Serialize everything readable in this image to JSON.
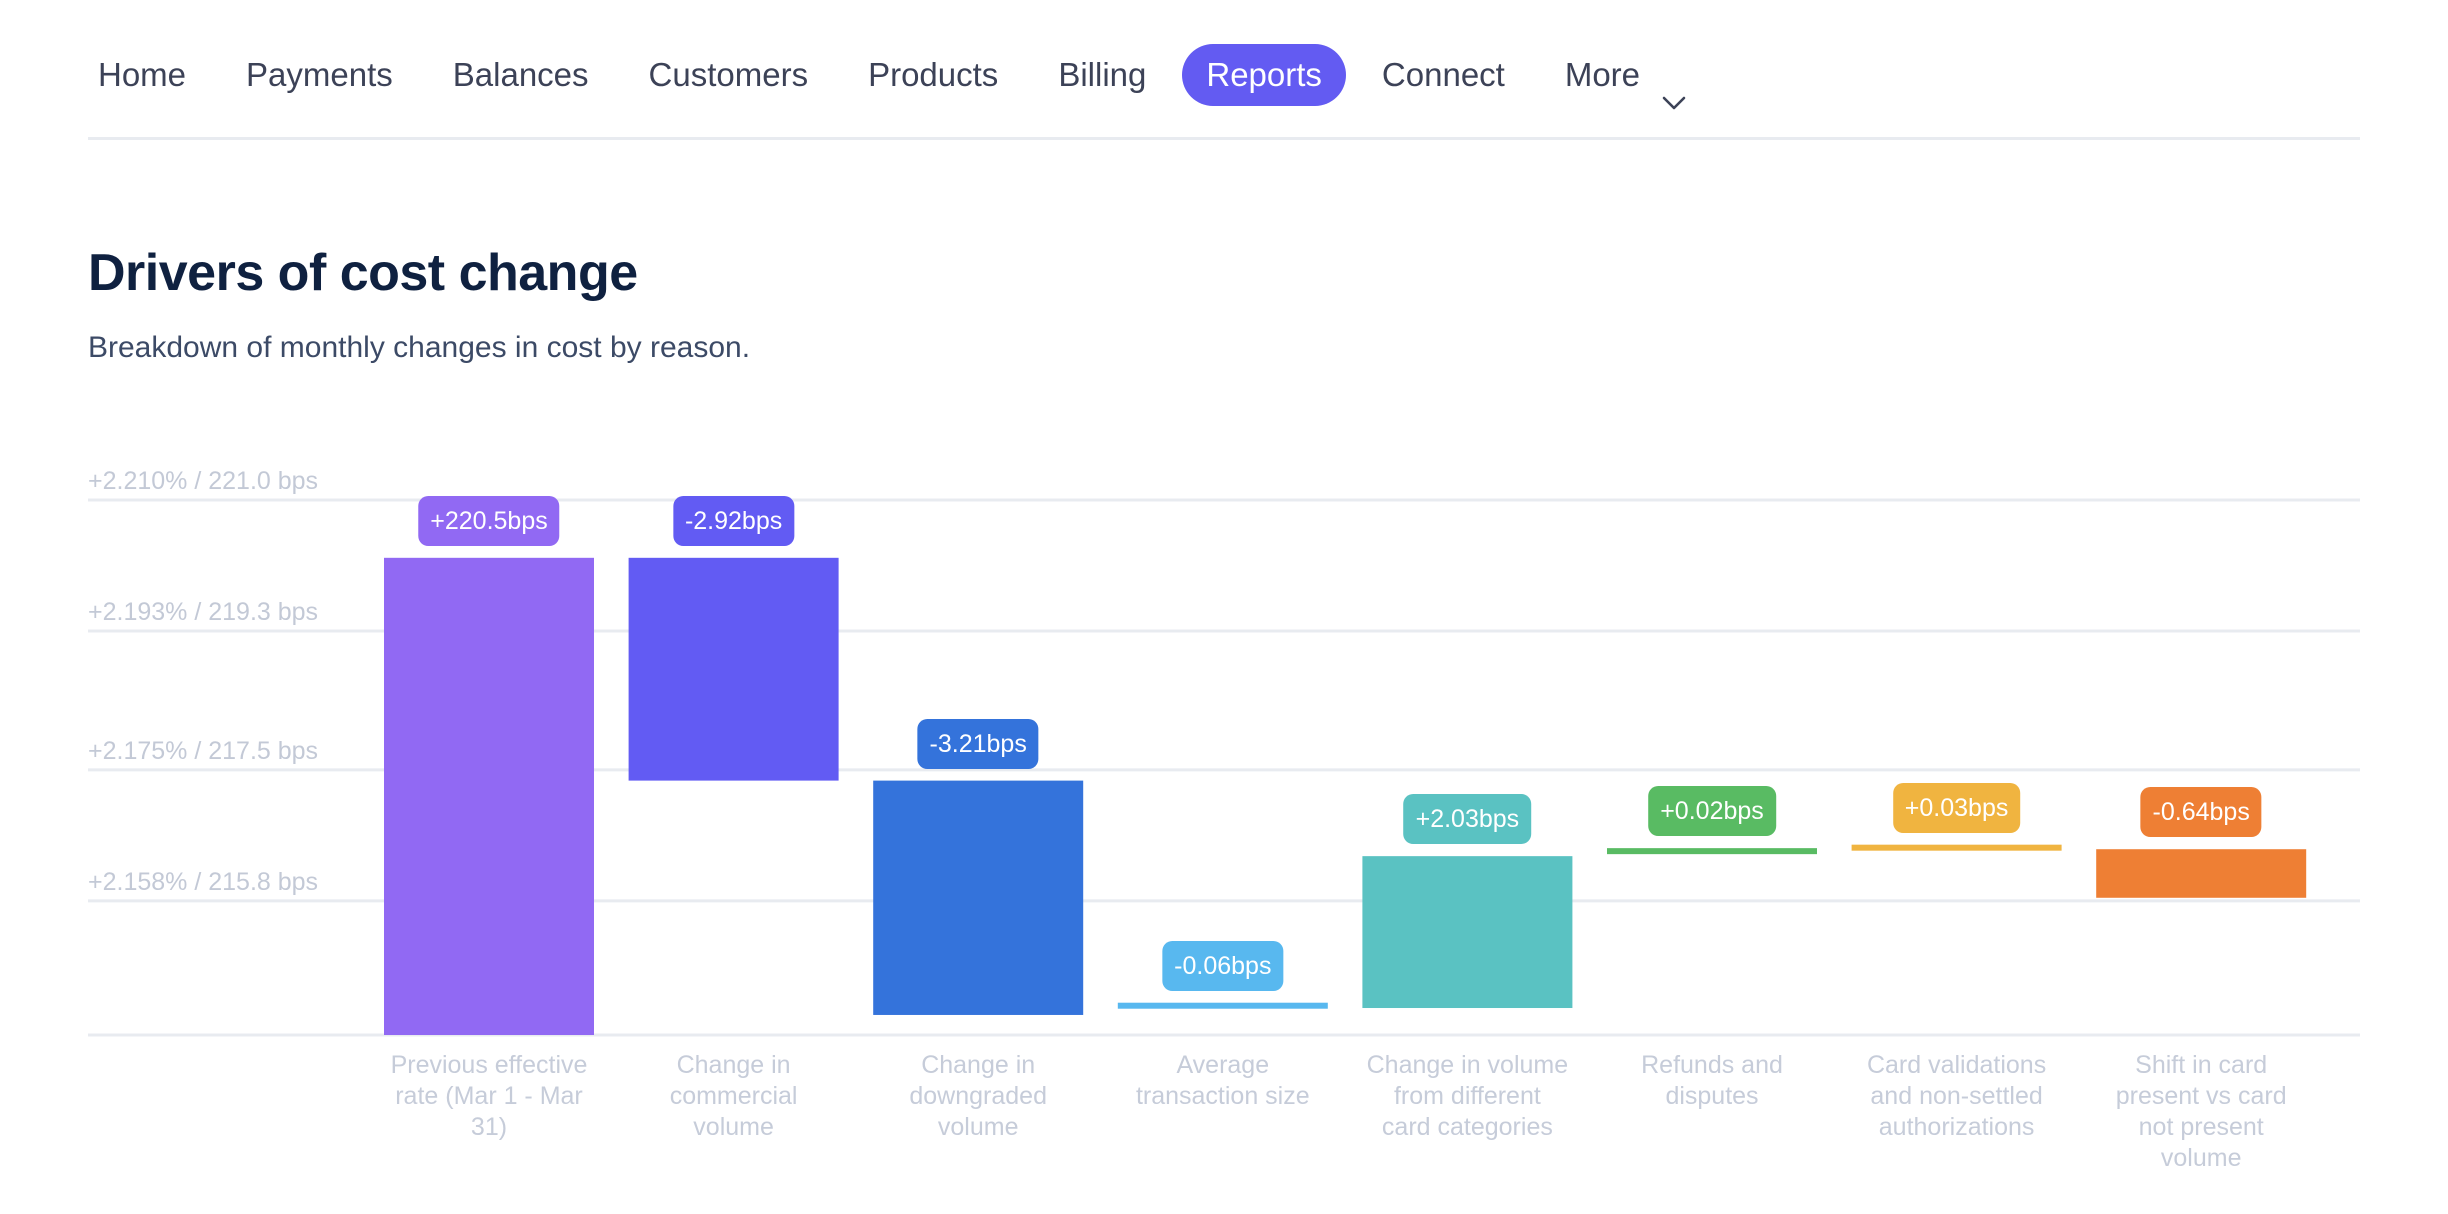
{
  "nav": {
    "items": [
      {
        "label": "Home",
        "active": false
      },
      {
        "label": "Payments",
        "active": false
      },
      {
        "label": "Balances",
        "active": false
      },
      {
        "label": "Customers",
        "active": false
      },
      {
        "label": "Products",
        "active": false
      },
      {
        "label": "Billing",
        "active": false
      },
      {
        "label": "Reports",
        "active": true
      },
      {
        "label": "Connect",
        "active": false
      },
      {
        "label": "More",
        "active": false,
        "icon": "chevron-down-icon"
      }
    ],
    "active_color": "#635bf2"
  },
  "header": {
    "title": "Drivers of cost change",
    "subtitle": "Breakdown of monthly changes in cost by reason."
  },
  "chart_data": {
    "type": "bar",
    "subtype": "waterfall",
    "title": "Drivers of cost change",
    "xlabel": "",
    "ylabel": "",
    "unit": "bps",
    "ylim": [
      214.06,
      221.0
    ],
    "grid": true,
    "y_ticks": [
      {
        "value": 221.0,
        "label": "+2.210% / 221.0 bps"
      },
      {
        "value": 219.3,
        "label": "+2.193% / 219.3 bps"
      },
      {
        "value": 217.5,
        "label": "+2.175% / 217.5 bps"
      },
      {
        "value": 215.8,
        "label": "+2.158% / 215.8 bps"
      }
    ],
    "categories": [
      "Previous effective rate (Mar 1 - Mar 31)",
      "Change in commercial volume",
      "Change in downgraded volume",
      "Average transaction size",
      "Change in volume from different card categories",
      "Refunds and disputes",
      "Card validations and non-settled authorizations",
      "Shift in card present vs card not present volume"
    ],
    "category_lines": [
      [
        "Previous effective",
        "rate (Mar 1 - Mar",
        "31)"
      ],
      [
        "Change in",
        "commercial",
        "volume"
      ],
      [
        "Change in",
        "downgraded",
        "volume"
      ],
      [
        "Average",
        "transaction size"
      ],
      [
        "Change in volume",
        "from different",
        "card categories"
      ],
      [
        "Refunds and",
        "disputes"
      ],
      [
        "Card validations",
        "and non-settled",
        "authorizations"
      ],
      [
        "Shift in card",
        "present vs card",
        "not present",
        "volume"
      ]
    ],
    "values": [
      220.5,
      -2.92,
      -3.21,
      -0.06,
      2.03,
      0.02,
      0.03,
      -0.64
    ],
    "value_labels": [
      "+220.5bps",
      "-2.92bps",
      "-3.21bps",
      "-0.06bps",
      "+2.03bps",
      "+0.02bps",
      "+0.03bps",
      "-0.64bps"
    ],
    "displayed_ranges": [
      [
        214.06,
        220.25
      ],
      [
        217.36,
        220.25
      ],
      [
        214.32,
        217.36
      ],
      [
        214.41,
        214.47
      ],
      [
        214.41,
        216.38
      ],
      [
        216.42,
        216.47
      ],
      [
        216.46,
        216.52
      ],
      [
        215.84,
        216.47
      ]
    ],
    "colors": [
      "#9169f3",
      "#625bf3",
      "#3473db",
      "#58b8ef",
      "#5ac2c2",
      "#59bb63",
      "#f0b440",
      "#ee7f34"
    ]
  }
}
